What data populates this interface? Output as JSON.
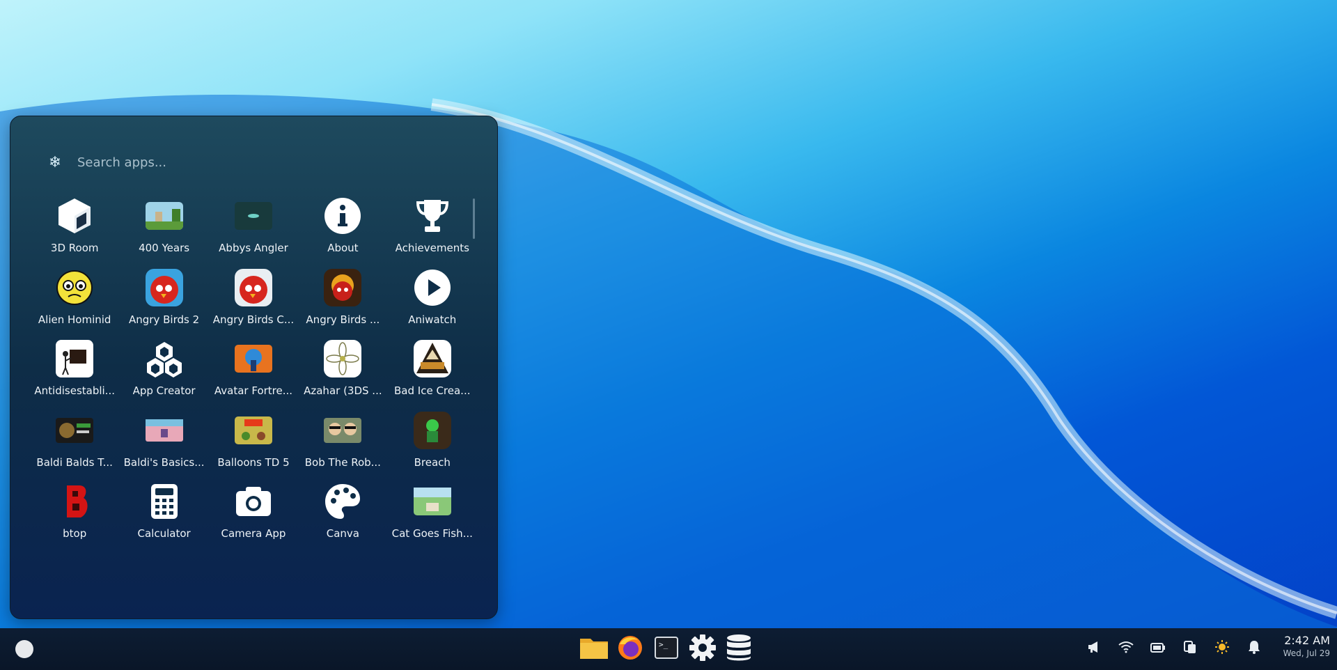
{
  "launcher": {
    "search": {
      "placeholder": "Search apps..."
    },
    "apps": [
      {
        "label": "3D Room",
        "icon": "cube-icon"
      },
      {
        "label": "400 Years",
        "icon": "pixel-scene-icon"
      },
      {
        "label": "Abbys Angler",
        "icon": "underwater-icon"
      },
      {
        "label": "About",
        "icon": "info-icon"
      },
      {
        "label": "Achievements",
        "icon": "trophy-icon"
      },
      {
        "label": "Alien Hominid",
        "icon": "alien-face-icon"
      },
      {
        "label": "Angry Birds 2",
        "icon": "red-bird-icon"
      },
      {
        "label": "Angry Birds C...",
        "icon": "red-bird-icon"
      },
      {
        "label": "Angry Birds ...",
        "icon": "red-bird-icon"
      },
      {
        "label": "Aniwatch",
        "icon": "play-icon"
      },
      {
        "label": "Antidisestabli...",
        "icon": "stick-figure-icon"
      },
      {
        "label": "App Creator",
        "icon": "cubes-icon"
      },
      {
        "label": "Avatar Fortre...",
        "icon": "avatar-game-icon"
      },
      {
        "label": "Azahar (3DS ...",
        "icon": "flower-icon"
      },
      {
        "label": "Bad Ice Crea...",
        "icon": "ice-cream-game-icon"
      },
      {
        "label": "Baldi Balds T...",
        "icon": "baldi-game-icon"
      },
      {
        "label": "Baldi's Basics...",
        "icon": "classroom-game-icon"
      },
      {
        "label": "Balloons TD 5",
        "icon": "balloons-game-icon"
      },
      {
        "label": "Bob The Rob...",
        "icon": "robber-game-icon"
      },
      {
        "label": "Breach",
        "icon": "breach-game-icon"
      },
      {
        "label": "btop",
        "icon": "btop-icon"
      },
      {
        "label": "Calculator",
        "icon": "calculator-icon"
      },
      {
        "label": "Camera App",
        "icon": "camera-icon"
      },
      {
        "label": "Canva",
        "icon": "palette-icon"
      },
      {
        "label": "Cat Goes Fish...",
        "icon": "cat-fishing-game-icon"
      }
    ]
  },
  "taskbar": {
    "dock": [
      {
        "name": "files",
        "icon": "folder-icon"
      },
      {
        "name": "firefox",
        "icon": "firefox-icon"
      },
      {
        "name": "terminal",
        "icon": "terminal-icon",
        "glyph": ">_"
      },
      {
        "name": "settings",
        "icon": "gear-icon"
      },
      {
        "name": "database",
        "icon": "database-icon"
      }
    ],
    "tray": [
      {
        "name": "announcements",
        "icon": "megaphone-icon"
      },
      {
        "name": "wifi",
        "icon": "wifi-icon"
      },
      {
        "name": "battery",
        "icon": "battery-icon"
      },
      {
        "name": "clipboard",
        "icon": "clipboard-icon"
      },
      {
        "name": "brightness",
        "icon": "sun-icon"
      },
      {
        "name": "notifications",
        "icon": "bell-icon"
      }
    ],
    "clock": {
      "time": "2:42 AM",
      "date": "Wed, Jul 29"
    }
  },
  "colors": {
    "accent_sun": "#f5b82a",
    "panel": "#0e2d47",
    "taskbar": "#0b1a2e"
  }
}
